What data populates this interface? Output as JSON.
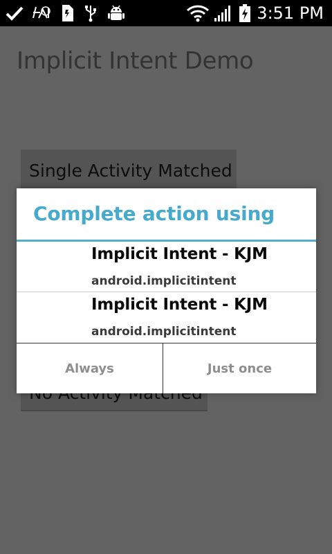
{
  "status_bar": {
    "time": "3:51 PM",
    "left_icons": [
      "checkmark-icon",
      "app-logo-icon",
      "sd-card-icon",
      "usb-icon",
      "android-debug-icon"
    ],
    "right_icons": [
      "wifi-icon",
      "signal-icon",
      "battery-charging-icon"
    ],
    "bundle_logo_text": "IZAT"
  },
  "activity": {
    "title": "Implicit Intent Demo",
    "button_single": "Single Activity Matched",
    "button_none": "No Activity Matched"
  },
  "dialog": {
    "title": "Complete action using",
    "items": [
      {
        "title": "Implicit Intent - KJM",
        "subtitle": "android.implicitintent"
      },
      {
        "title": "Implicit Intent - KJM",
        "subtitle": "android.implicitintent"
      }
    ],
    "always_label": "Always",
    "just_once_label": "Just once"
  },
  "colors": {
    "accent": "#46aacd",
    "scrim_background": "#636363"
  }
}
